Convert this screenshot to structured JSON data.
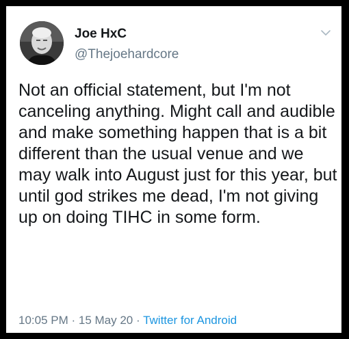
{
  "tweet": {
    "display_name": "Joe HxC",
    "handle": "@Thejoehardcore",
    "text": "Not an official statement, but I'm not canceling anything. Might call and audible and make something happen that is a bit different than the usual venue and we may walk into August just for this year, but until god strikes me dead, I'm not giving up on doing TIHC in some form.",
    "time": "10:05 PM",
    "separator": " · ",
    "date": "15 May 20",
    "source": "Twitter for Android"
  },
  "icons": {
    "menu": "chevron-down-icon",
    "avatar": "profile-photo"
  },
  "colors": {
    "name": "#14171a",
    "handle": "#657786",
    "source_link": "#1b95e0",
    "frame": "#000000"
  }
}
